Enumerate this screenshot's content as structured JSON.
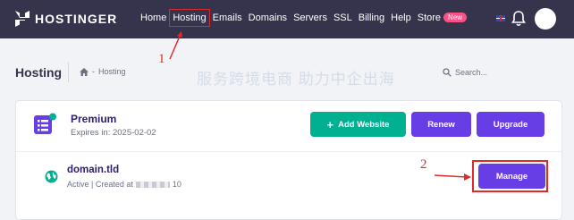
{
  "brand": {
    "name": "HOSTINGER"
  },
  "nav": {
    "items": [
      {
        "label": "Home"
      },
      {
        "label": "Hosting"
      },
      {
        "label": "Emails"
      },
      {
        "label": "Domains"
      },
      {
        "label": "Servers"
      },
      {
        "label": "SSL"
      },
      {
        "label": "Billing"
      },
      {
        "label": "Help"
      },
      {
        "label": "Store"
      }
    ],
    "store_badge": "New"
  },
  "icons": {
    "flag": "uk-flag-icon",
    "bell": "bell-icon",
    "home": "home-icon",
    "search": "search-icon",
    "plan": "plan-document-icon",
    "globe": "globe-icon"
  },
  "page": {
    "title": "Hosting",
    "breadcrumb": "Hosting"
  },
  "search": {
    "placeholder": "Search..."
  },
  "plan": {
    "name": "Premium",
    "expires": "Expires in: 2025-02-02",
    "buttons": {
      "add": "Add Website",
      "renew": "Renew",
      "upgrade": "Upgrade"
    }
  },
  "domain": {
    "name": "domain.tld",
    "status_prefix": "Active | Created at",
    "status_suffix": "10",
    "manage": "Manage"
  },
  "annotations": {
    "step1": "1",
    "step2": "2"
  },
  "watermark": {
    "text": "服务跨境电商 助力中企出海"
  },
  "colors": {
    "topbar": "#36344d",
    "primary": "#673de6",
    "success": "#00b090",
    "badge": "#fc5185",
    "annotation": "#e02a2a"
  }
}
